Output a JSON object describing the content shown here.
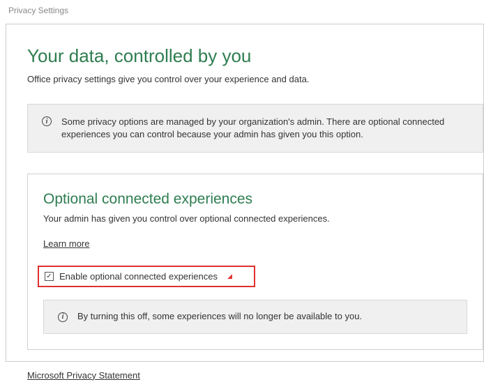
{
  "window": {
    "title": "Privacy Settings"
  },
  "page": {
    "heading": "Your data, controlled by you",
    "subtitle": "Office privacy settings give you control over your experience and data."
  },
  "adminBanner": {
    "text": "Some privacy options are managed by your organization's admin. There are optional connected experiences you can control because your admin has given you this option."
  },
  "optionalSection": {
    "heading": "Optional connected experiences",
    "description": "Your admin has given you control over optional connected experiences.",
    "learnMore": "Learn more",
    "checkboxLabel": "Enable optional connected experiences",
    "checkboxChecked": true,
    "innerInfo": "By turning this off, some experiences will no longer be available to you."
  },
  "footer": {
    "privacyStatement": "Microsoft Privacy Statement"
  }
}
